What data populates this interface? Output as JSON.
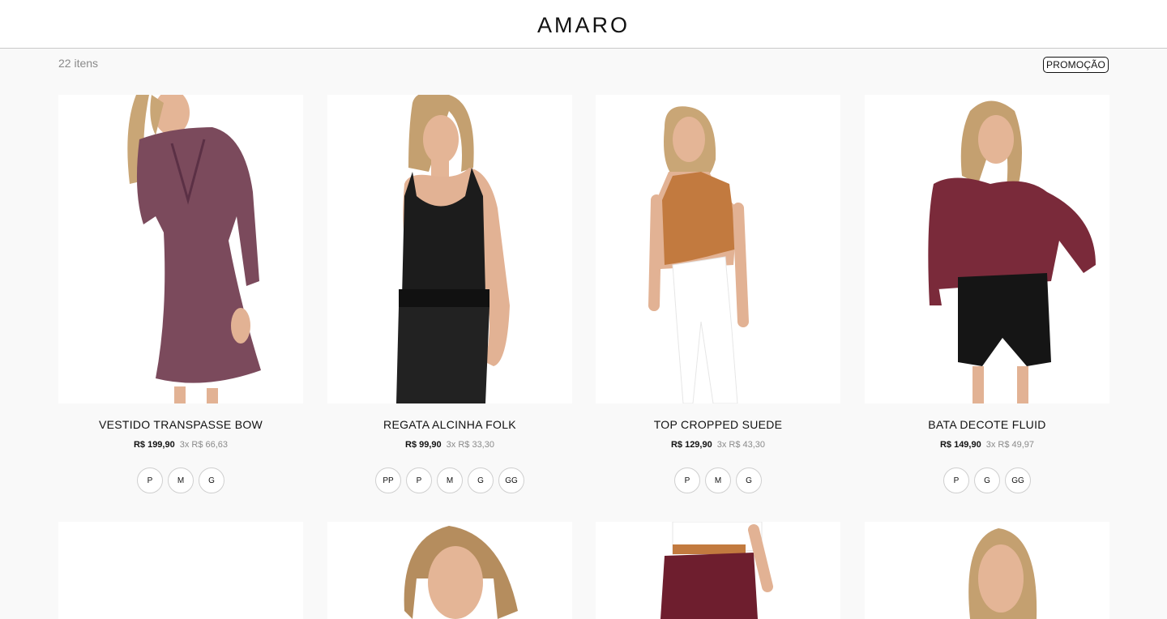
{
  "brand": {
    "logo": "AMARO"
  },
  "listing": {
    "count_label": "22 itens",
    "filter_label": "PROMOÇÃO"
  },
  "products": [
    {
      "name": "VESTIDO TRANSPASSE BOW",
      "price": "R$ 199,90",
      "installments": "3x R$ 66,63",
      "sizes": [
        "P",
        "M",
        "G"
      ]
    },
    {
      "name": "REGATA ALCINHA FOLK",
      "price": "R$ 99,90",
      "installments": "3x R$ 33,30",
      "sizes": [
        "PP",
        "P",
        "M",
        "G",
        "GG"
      ]
    },
    {
      "name": "TOP CROPPED SUEDE",
      "price": "R$ 129,90",
      "installments": "3x R$ 43,30",
      "sizes": [
        "P",
        "M",
        "G"
      ]
    },
    {
      "name": "BATA DECOTE FLUID",
      "price": "R$ 149,90",
      "installments": "3x R$ 49,97",
      "sizes": [
        "P",
        "G",
        "GG"
      ]
    }
  ],
  "colors": {
    "background": "#f9f9f9",
    "dress": "#7b4a5c",
    "tank": "#1c1c1c",
    "suede": "#c27a3f",
    "bata": "#7a2a3a",
    "skin": "#e2b294",
    "hair": "#c4a070"
  }
}
